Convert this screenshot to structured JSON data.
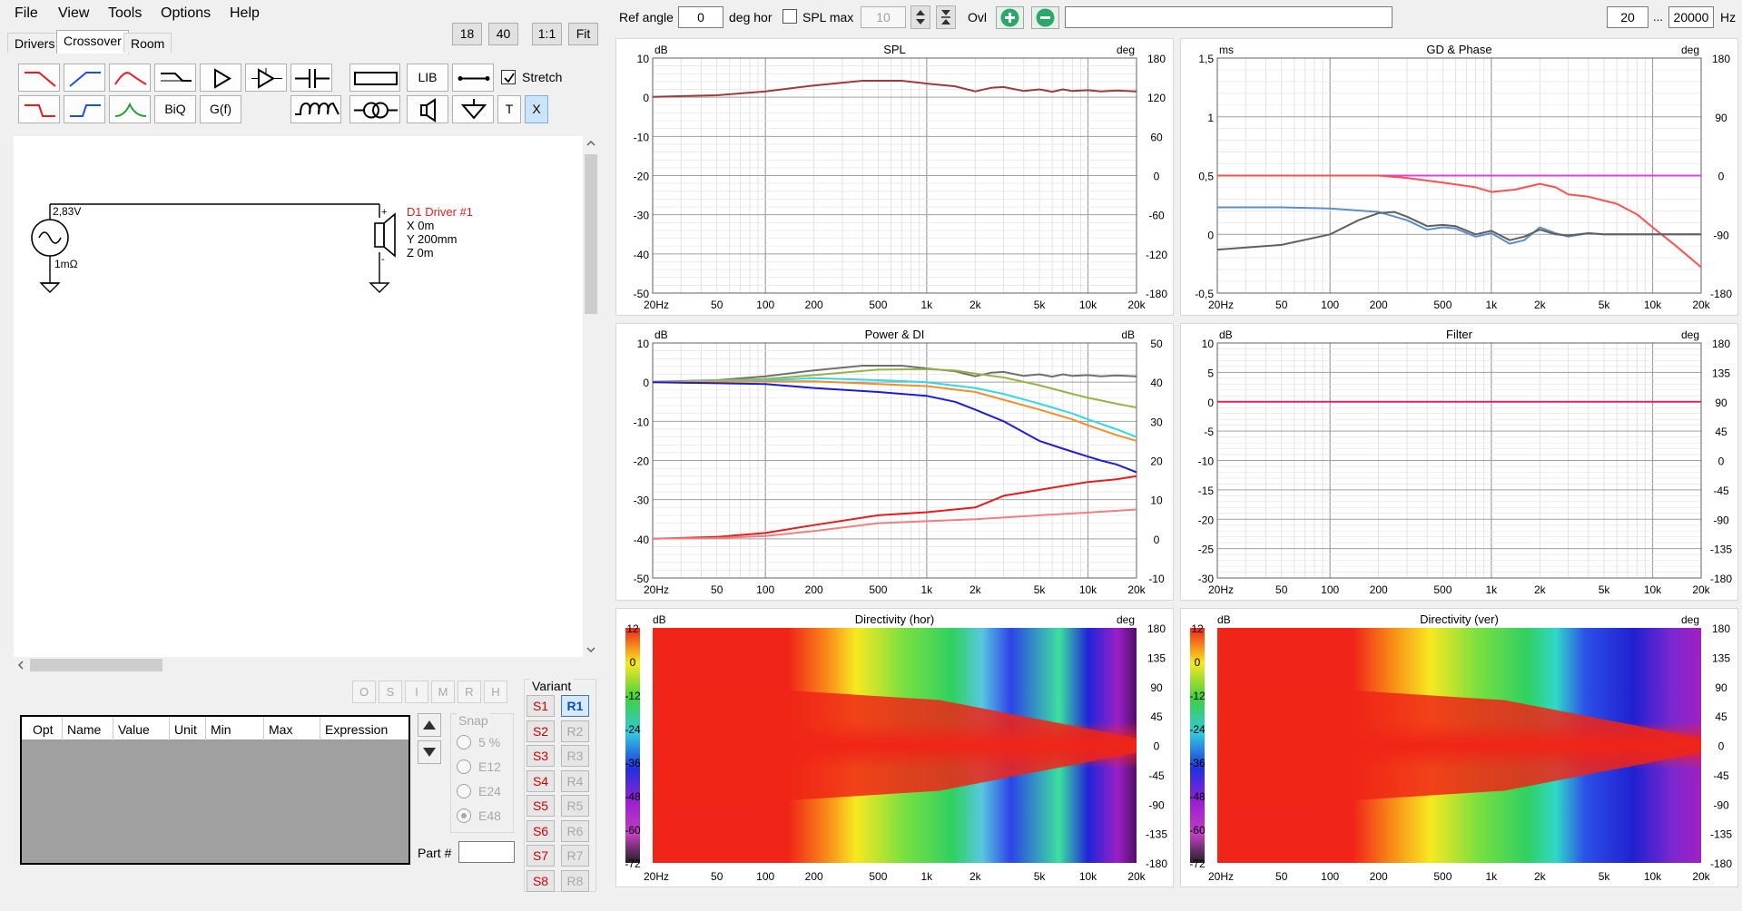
{
  "menu": [
    {
      "label": "File",
      "name": "menu-file"
    },
    {
      "label": "View",
      "name": "menu-view"
    },
    {
      "label": "Tools",
      "name": "menu-tools"
    },
    {
      "label": "Options",
      "name": "menu-options"
    },
    {
      "label": "Help",
      "name": "menu-help"
    }
  ],
  "tabs": [
    {
      "label": "Drivers",
      "name": "tab-drivers"
    },
    {
      "label": "Crossover",
      "name": "tab-crossover",
      "active": true
    },
    {
      "label": "Room",
      "name": "tab-room"
    }
  ],
  "scale_buttons": [
    {
      "label": "18",
      "name": "scale-18-button"
    },
    {
      "label": "40",
      "name": "scale-40-button"
    },
    {
      "label": "1:1",
      "name": "scale-1to1-button"
    },
    {
      "label": "Fit",
      "name": "scale-fit-button"
    }
  ],
  "toolbar": {
    "lib_label": "LIB",
    "biq_label": "BiQ",
    "gf_label": "G(f)",
    "t_label": "T",
    "x_label": "X",
    "stretch_label": "Stretch",
    "stretch_checked": true
  },
  "schematic": {
    "source_voltage": "2,83V",
    "source_impedance": "1mΩ",
    "driver_name": "D1 Driver #1",
    "driver_x": "X 0m",
    "driver_y": "Y 200mm",
    "driver_z": "Z 0m",
    "plus": "+",
    "minus": "-"
  },
  "opt_buttons": [
    "O",
    "S",
    "I",
    "M",
    "R",
    "H"
  ],
  "param_table": {
    "columns": [
      "Opt",
      "Name",
      "Value",
      "Unit",
      "Min",
      "Max",
      "Expression"
    ]
  },
  "snap": {
    "label": "Snap",
    "options": [
      {
        "label": "5 %",
        "selected": false
      },
      {
        "label": "E12",
        "selected": false
      },
      {
        "label": "E24",
        "selected": false
      },
      {
        "label": "E48",
        "selected": true
      }
    ]
  },
  "part_label": "Part #",
  "variant": {
    "label": "Variant",
    "s_items": [
      "S1",
      "S2",
      "S3",
      "S4",
      "S5",
      "S6",
      "S7",
      "S8"
    ],
    "r_items": [
      "R1",
      "R2",
      "R3",
      "R4",
      "R5",
      "R6",
      "R7",
      "R8"
    ],
    "active_r": "R1"
  },
  "top_bar": {
    "ref_angle_label": "Ref angle",
    "ref_angle_value": "0",
    "deg_hor_label": "deg hor",
    "spl_max_label": "SPL max",
    "spl_max_value": "10",
    "spl_max_checked": false,
    "ovl_label": "Ovl",
    "freq_min": "20",
    "freq_sep": "...",
    "freq_max": "20000",
    "hz_label": "Hz",
    "text_value": ""
  },
  "colors": {
    "spl": "#a33a3a",
    "gd_red": "#ff5050",
    "gd_magenta": "#e040e0",
    "gd_blue": "#5a8fc8",
    "gd_grey": "#606060",
    "filter": "#e0206a",
    "power_grey": "#707070",
    "power_olive": "#96b446",
    "power_cyan": "#30d8e8",
    "power_orange": "#f0902c",
    "power_blue": "#1c1ce0",
    "power_red": "#e81c1c",
    "power_salmon": "#f08080"
  },
  "chart_data": [
    {
      "id": "spl",
      "type": "line",
      "title": "SPL",
      "ylabel_left": "dB",
      "ylabel_right": "deg",
      "x_ticks": [
        "20Hz",
        "50",
        "100",
        "200",
        "500",
        "1k",
        "2k",
        "5k",
        "10k",
        "20k"
      ],
      "y_ticks_left": [
        "10",
        "0",
        "-10",
        "-20",
        "-30",
        "-40",
        "-50"
      ],
      "y_ticks_right": [
        "180",
        "120",
        "60",
        "0",
        "-60",
        "-120",
        "-180"
      ],
      "xlim": [
        20,
        20000
      ],
      "ylim": [
        -50,
        10
      ],
      "x_scale": "log",
      "series": [
        {
          "color": "#a33a3a",
          "x": [
            20,
            50,
            100,
            200,
            400,
            700,
            1000,
            1500,
            2000,
            2500,
            3000,
            4000,
            5000,
            6000,
            7000,
            8000,
            10000,
            12000,
            15000,
            20000
          ],
          "y": [
            0.1,
            0.5,
            1.5,
            3,
            4.2,
            4.2,
            3.5,
            2.8,
            1.5,
            2.4,
            2.6,
            1.6,
            2.0,
            1.4,
            2.0,
            1.6,
            1.8,
            1.5,
            1.7,
            1.5
          ]
        }
      ]
    },
    {
      "id": "gd_phase",
      "type": "line",
      "title": "GD & Phase",
      "ylabel_left": "ms",
      "ylabel_right": "deg",
      "x_ticks": [
        "20Hz",
        "50",
        "100",
        "200",
        "500",
        "1k",
        "2k",
        "5k",
        "10k",
        "20k"
      ],
      "y_ticks_left": [
        "1,5",
        "1",
        "0,5",
        "0",
        "-0,5"
      ],
      "y_ticks_right": [
        "180",
        "90",
        "0",
        "-90",
        "-180"
      ],
      "xlim": [
        20,
        20000
      ],
      "ylim": [
        -0.5,
        1.5
      ],
      "x_scale": "log",
      "series": [
        {
          "color": "#e040e0",
          "x": [
            20,
            20000
          ],
          "y": [
            0.5,
            0.5
          ]
        },
        {
          "color": "#ff5050",
          "x": [
            20,
            100,
            200,
            300,
            500,
            800,
            1000,
            1400,
            2000,
            2500,
            3000,
            4000,
            6000,
            8000,
            10000,
            14000,
            20000
          ],
          "y": [
            0.5,
            0.5,
            0.5,
            0.48,
            0.44,
            0.4,
            0.36,
            0.38,
            0.43,
            0.4,
            0.34,
            0.32,
            0.26,
            0.17,
            0.06,
            -0.1,
            -0.28
          ]
        },
        {
          "color": "#5a8fc8",
          "x": [
            20,
            50,
            100,
            200,
            300,
            400,
            500,
            600,
            800,
            1000,
            1300,
            1600,
            2000,
            2500,
            3000,
            4000,
            5000,
            8000,
            20000
          ],
          "y": [
            0.23,
            0.23,
            0.22,
            0.19,
            0.12,
            0.04,
            0.06,
            0.05,
            -0.02,
            0.01,
            -0.08,
            -0.05,
            0.06,
            0.01,
            -0.02,
            0.01,
            0.0,
            0.0,
            0.0
          ]
        },
        {
          "color": "#606060",
          "x": [
            20,
            50,
            100,
            150,
            200,
            250,
            300,
            400,
            500,
            600,
            800,
            1000,
            1300,
            1600,
            2000,
            2500,
            3000,
            4000,
            5000,
            8000,
            20000
          ],
          "y": [
            -0.13,
            -0.09,
            0.0,
            0.12,
            0.18,
            0.19,
            0.15,
            0.07,
            0.08,
            0.07,
            0.0,
            0.03,
            -0.05,
            -0.02,
            0.04,
            0.0,
            -0.01,
            0.01,
            0.0,
            0.0,
            0.0
          ]
        }
      ]
    },
    {
      "id": "power_di",
      "type": "line",
      "title": "Power & DI",
      "ylabel_left": "dB",
      "ylabel_right": "dB",
      "x_ticks": [
        "20Hz",
        "50",
        "100",
        "200",
        "500",
        "1k",
        "2k",
        "5k",
        "10k",
        "20k"
      ],
      "y_ticks_left": [
        "10",
        "0",
        "-10",
        "-20",
        "-30",
        "-40",
        "-50"
      ],
      "y_ticks_right": [
        "50",
        "40",
        "30",
        "20",
        "10",
        "0",
        "-10"
      ],
      "xlim": [
        20,
        20000
      ],
      "ylim": [
        -50,
        10
      ],
      "x_scale": "log",
      "series": [
        {
          "color": "#707070",
          "x": [
            20,
            50,
            100,
            200,
            400,
            700,
            1000,
            1500,
            2000,
            2500,
            3000,
            4000,
            5000,
            6000,
            7000,
            8000,
            10000,
            12000,
            15000,
            20000
          ],
          "y": [
            0.1,
            0.5,
            1.5,
            3,
            4.2,
            4.2,
            3.5,
            2.8,
            1.5,
            2.4,
            2.6,
            1.6,
            2.0,
            1.4,
            2.0,
            1.6,
            1.8,
            1.5,
            1.7,
            1.5
          ]
        },
        {
          "color": "#96b446",
          "x": [
            20,
            100,
            200,
            500,
            1000,
            1500,
            2000,
            3000,
            5000,
            8000,
            10000,
            15000,
            20000
          ],
          "y": [
            0,
            0.8,
            1.8,
            3.2,
            3.3,
            3,
            2.2,
            1.2,
            -0.8,
            -3,
            -4,
            -5.5,
            -6.5
          ]
        },
        {
          "color": "#30d8e8",
          "x": [
            20,
            100,
            200,
            500,
            1000,
            2000,
            3000,
            5000,
            8000,
            10000,
            15000,
            20000
          ],
          "y": [
            0,
            0.5,
            1.0,
            0.5,
            0,
            -1.5,
            -3,
            -5.5,
            -8,
            -9.5,
            -12,
            -14
          ]
        },
        {
          "color": "#f0902c",
          "x": [
            20,
            100,
            200,
            500,
            1000,
            2000,
            3000,
            5000,
            8000,
            10000,
            15000,
            20000
          ],
          "y": [
            0,
            0.2,
            0.2,
            -0.5,
            -1,
            -2.5,
            -4.5,
            -7,
            -9.5,
            -11,
            -13.5,
            -15
          ]
        },
        {
          "color": "#1c1ce0",
          "x": [
            20,
            100,
            200,
            500,
            1000,
            1500,
            2000,
            3000,
            5000,
            7000,
            10000,
            12000,
            15000,
            20000
          ],
          "y": [
            0,
            -0.5,
            -1.5,
            -2.5,
            -3.5,
            -5,
            -7,
            -10,
            -15,
            -17,
            -19,
            -20,
            -21,
            -23
          ]
        },
        {
          "color": "#e81c1c",
          "x": [
            20,
            50,
            100,
            200,
            500,
            1000,
            2000,
            3000,
            5000,
            7000,
            10000,
            15000,
            20000
          ],
          "y": [
            -40,
            -39.5,
            -38.5,
            -36.5,
            -34,
            -33.2,
            -32,
            -29,
            -27.5,
            -26.5,
            -25.5,
            -24.8,
            -24
          ]
        },
        {
          "color": "#f08080",
          "x": [
            20,
            50,
            100,
            200,
            500,
            1000,
            2000,
            5000,
            10000,
            20000
          ],
          "y": [
            -40,
            -39.8,
            -39.3,
            -38,
            -36,
            -35.5,
            -35,
            -34,
            -33.3,
            -32.5
          ]
        }
      ]
    },
    {
      "id": "filter",
      "type": "line",
      "title": "Filter",
      "ylabel_left": "dB",
      "ylabel_right": "deg",
      "x_ticks": [
        "20Hz",
        "50",
        "100",
        "200",
        "500",
        "1k",
        "2k",
        "5k",
        "10k",
        "20k"
      ],
      "y_ticks_left": [
        "10",
        "5",
        "0",
        "-5",
        "-10",
        "-15",
        "-20",
        "-25",
        "-30"
      ],
      "y_ticks_right": [
        "180",
        "135",
        "90",
        "45",
        "0",
        "-45",
        "-90",
        "-135",
        "-180"
      ],
      "xlim": [
        20,
        20000
      ],
      "ylim": [
        -30,
        10
      ],
      "x_scale": "log",
      "series": [
        {
          "color": "#e0206a",
          "x": [
            20,
            20000
          ],
          "y": [
            0,
            0
          ]
        }
      ]
    },
    {
      "id": "dir_hor",
      "type": "heatmap",
      "title": "Directivity (hor)",
      "ylabel_left": "dB",
      "ylabel_right": "deg",
      "x_ticks": [
        "20Hz",
        "50",
        "100",
        "200",
        "500",
        "1k",
        "2k",
        "5k",
        "10k",
        "20k"
      ],
      "scale_ticks": [
        "12",
        "0",
        "-12",
        "-24",
        "-36",
        "-48",
        "-60",
        "-72"
      ],
      "y_ticks_right": [
        "180",
        "135",
        "90",
        "45",
        "0",
        "-45",
        "-90",
        "-135",
        "-180"
      ]
    },
    {
      "id": "dir_ver",
      "type": "heatmap",
      "title": "Directivity (ver)",
      "ylabel_left": "dB",
      "ylabel_right": "deg",
      "x_ticks": [
        "20Hz",
        "50",
        "100",
        "200",
        "500",
        "1k",
        "2k",
        "5k",
        "10k",
        "20k"
      ],
      "scale_ticks": [
        "12",
        "0",
        "-12",
        "-24",
        "-36",
        "-48",
        "-60",
        "-72"
      ],
      "y_ticks_right": [
        "180",
        "135",
        "90",
        "45",
        "0",
        "-45",
        "-90",
        "-135",
        "-180"
      ]
    }
  ]
}
